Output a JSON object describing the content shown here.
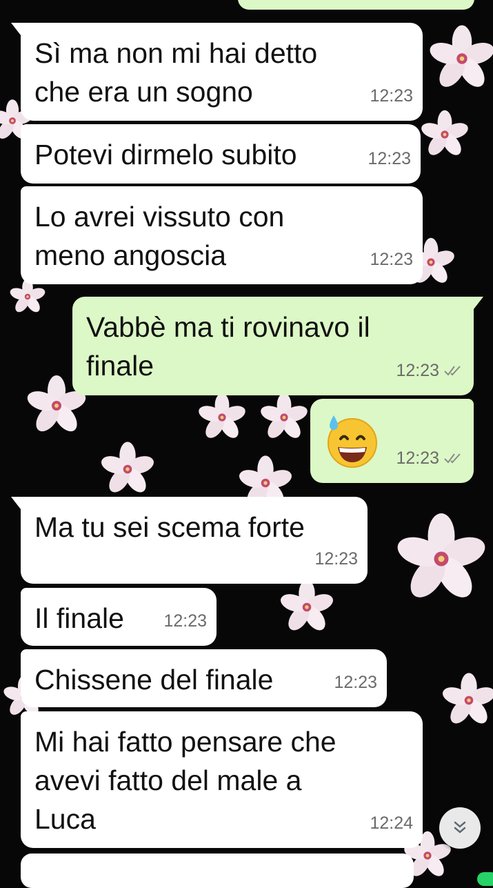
{
  "messages": [
    {
      "dir": "in",
      "text": "Sì ma non mi hai detto\nche era un sogno",
      "time": "12:23"
    },
    {
      "dir": "in",
      "text": "Potevi dirmelo subito",
      "time": "12:23"
    },
    {
      "dir": "in",
      "text": "Lo avrei vissuto con\nmeno angoscia",
      "time": "12:23"
    },
    {
      "dir": "out",
      "text": "Vabbè ma ti rovinavo il\nfinale",
      "time": "12:23",
      "status": "read"
    },
    {
      "dir": "out",
      "emoji": "grinning-face-with-sweat",
      "time": "12:23",
      "status": "read"
    },
    {
      "dir": "in",
      "text": "Ma tu sei scema forte",
      "time": "12:23"
    },
    {
      "dir": "in",
      "text": "Il finale",
      "time": "12:23"
    },
    {
      "dir": "in",
      "text": "Chissene del finale",
      "time": "12:23"
    },
    {
      "dir": "in",
      "text": "Mi hai fatto pensare che\navevi fatto del male a\nLuca",
      "time": "12:24"
    }
  ],
  "scroll_down_icon": "double-chevron-down-icon",
  "colors": {
    "incoming": "#ffffff",
    "outgoing": "#dcf8c6",
    "background": "#070707"
  }
}
